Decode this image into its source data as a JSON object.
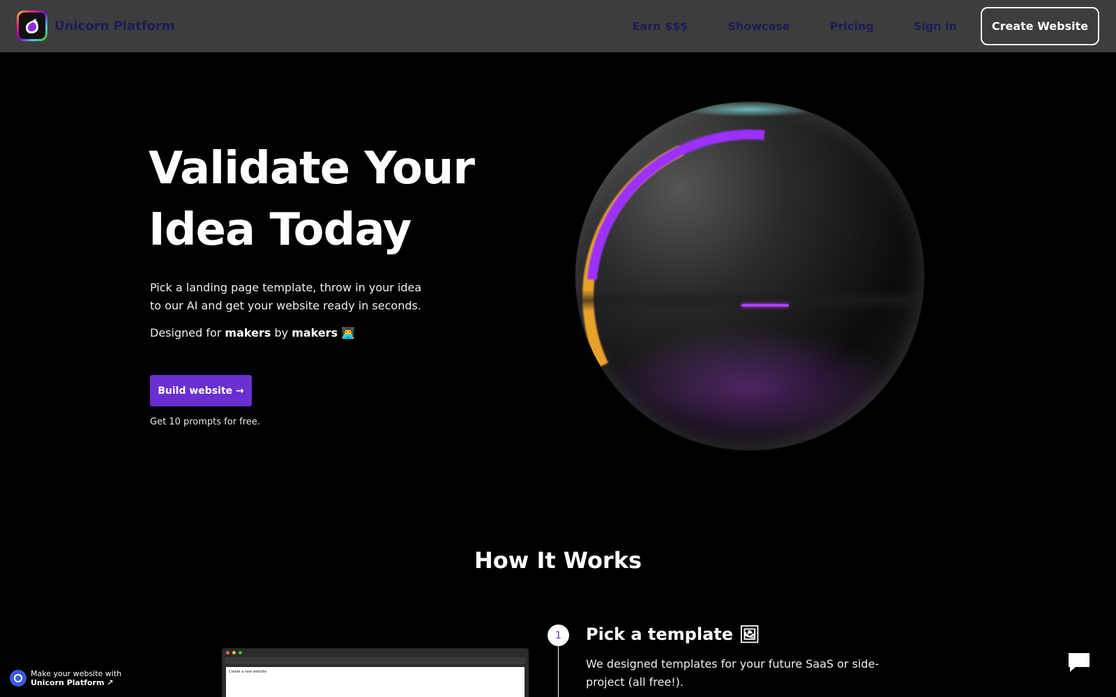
{
  "nav": {
    "brand": "Unicorn Platform",
    "links": [
      "Earn $$$",
      "Showcase",
      "Pricing",
      "Sign in"
    ],
    "cta": "Create Website"
  },
  "hero": {
    "title_line1": "Validate Your",
    "title_line2": "Idea Today",
    "description": "Pick a landing page template, throw in your idea to our AI and get your website ready in seconds.",
    "designed_prefix": "Designed for",
    "designed_makers1": "makers",
    "designed_by": "by",
    "designed_makers2": "makers",
    "designed_emoji": "👨‍💻",
    "button": "Build website →",
    "note": "Get 10 prompts for free."
  },
  "how": {
    "title": "How It Works",
    "step_number": "1",
    "step_title": "Pick a template 🖼",
    "step_desc": "We designed templates for your future SaaS or side-project (all free!).",
    "mock_title": "Create a new website"
  },
  "badge": {
    "line1": "Make your website with",
    "line2": "Unicorn Platform ↗"
  },
  "colors": {
    "nav_bg": "#3d3d3d",
    "accent": "#6a2fd0",
    "nav_link": "#1c1c5a"
  }
}
